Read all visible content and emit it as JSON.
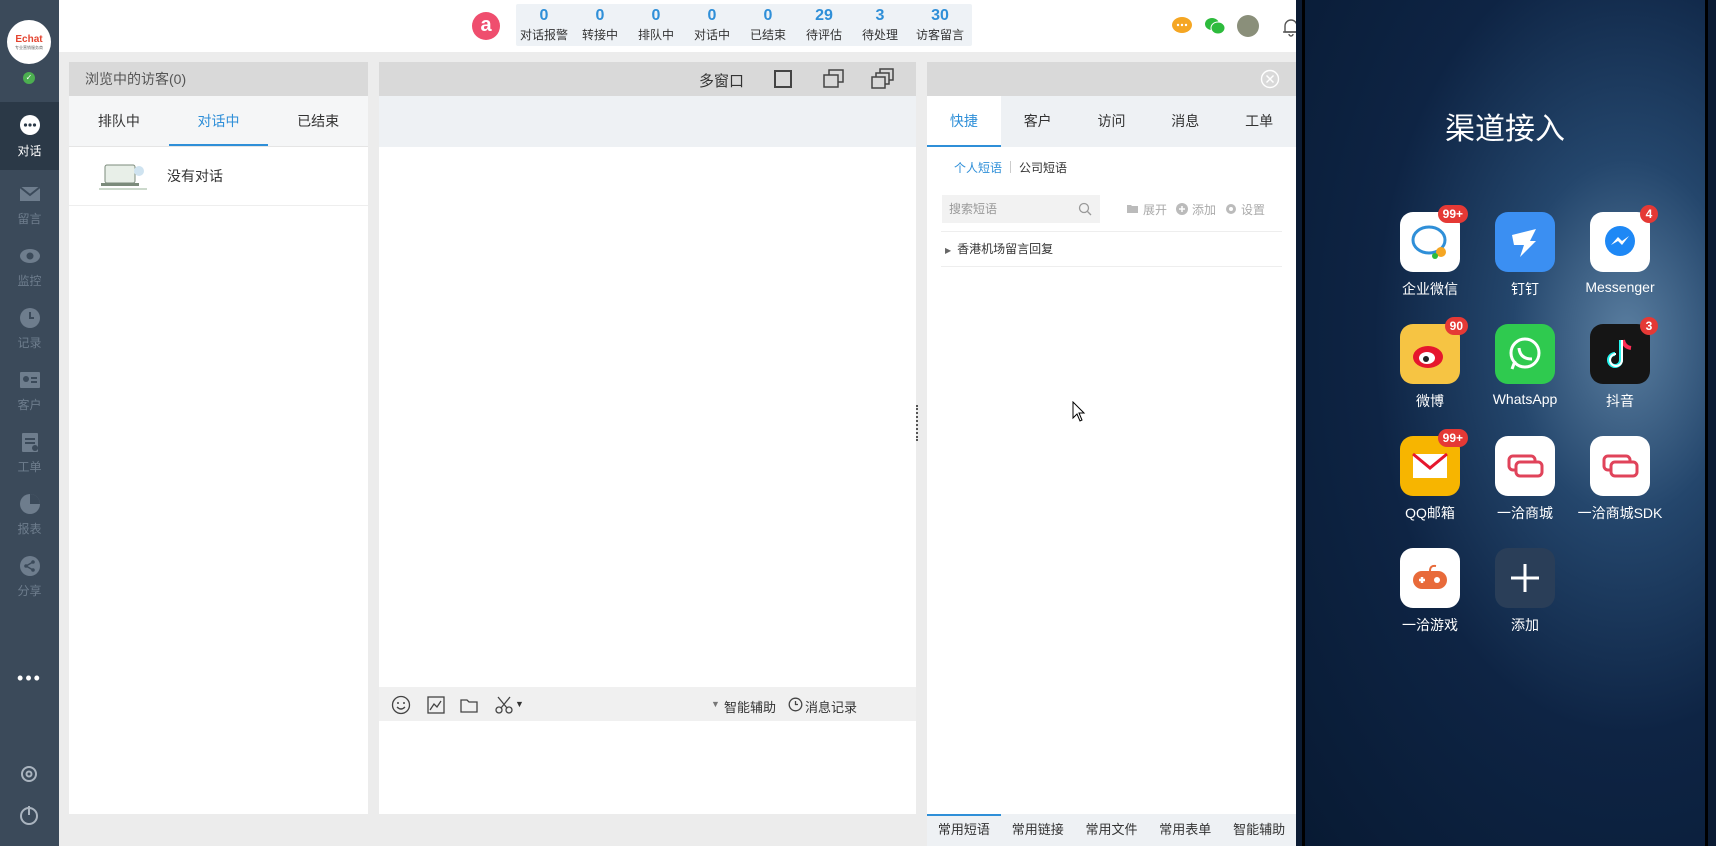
{
  "colors": {
    "accent": "#2f8fd8",
    "nav_bg": "#3b4a5a",
    "brand": "#ef4e6e"
  },
  "logo": {
    "text": "Echat",
    "sub": "专业营销服务商"
  },
  "nav": {
    "items": [
      {
        "label": "对话",
        "icon": "chat-icon"
      },
      {
        "label": "留言",
        "icon": "mail-icon"
      },
      {
        "label": "监控",
        "icon": "eye-icon"
      },
      {
        "label": "记录",
        "icon": "clock-icon"
      },
      {
        "label": "客户",
        "icon": "contact-card-icon"
      },
      {
        "label": "工单",
        "icon": "clipboard-icon"
      },
      {
        "label": "报表",
        "icon": "pie-chart-icon"
      },
      {
        "label": "分享",
        "icon": "share-icon"
      }
    ],
    "more": "•••"
  },
  "stats": [
    {
      "num": "0",
      "label": "对话报警"
    },
    {
      "num": "0",
      "label": "转接中"
    },
    {
      "num": "0",
      "label": "排队中"
    },
    {
      "num": "0",
      "label": "对话中"
    },
    {
      "num": "0",
      "label": "已结束"
    },
    {
      "num": "29",
      "label": "待评估"
    },
    {
      "num": "3",
      "label": "待处理"
    },
    {
      "num": "30",
      "label": "访客留言"
    }
  ],
  "visitors": {
    "title": "浏览中的访客(0)",
    "tabs": [
      "排队中",
      "对话中",
      "已结束"
    ],
    "empty": "没有对话"
  },
  "chat": {
    "multi_window": "多窗口",
    "smart_assist": "智能辅助",
    "history": "消息记录"
  },
  "right": {
    "tabs": [
      "快捷",
      "客户",
      "访问",
      "消息",
      "工单"
    ],
    "subtabs": [
      "个人短语",
      "公司短语"
    ],
    "search_placeholder": "搜索短语",
    "actions": [
      "展开",
      "添加",
      "设置"
    ],
    "group": "香港机场留言回复",
    "bottom_tabs": [
      "常用短语",
      "常用链接",
      "常用文件",
      "常用表单",
      "智能辅助"
    ]
  },
  "phone": {
    "title": "渠道接入",
    "apps": [
      {
        "name": "企业微信",
        "badge": "99+",
        "color": "#ffffff"
      },
      {
        "name": "钉钉",
        "badge": "",
        "color": "#3b8ff2"
      },
      {
        "name": "Messenger",
        "badge": "4",
        "color": "#ffffff"
      },
      {
        "name": "微博",
        "badge": "90",
        "color": "#f6c443"
      },
      {
        "name": "WhatsApp",
        "badge": "",
        "color": "#2fca4f"
      },
      {
        "name": "抖音",
        "badge": "3",
        "color": "#151515"
      },
      {
        "name": "QQ邮箱",
        "badge": "99+",
        "color": "#f7b500"
      },
      {
        "name": "一洽商城",
        "badge": "",
        "color": "#ffffff"
      },
      {
        "name": "一洽商城SDK",
        "badge": "",
        "color": "#ffffff"
      },
      {
        "name": "一洽游戏",
        "badge": "",
        "color": "#ffffff"
      },
      {
        "name": "添加",
        "badge": "",
        "color": "#2a3e58"
      }
    ]
  }
}
